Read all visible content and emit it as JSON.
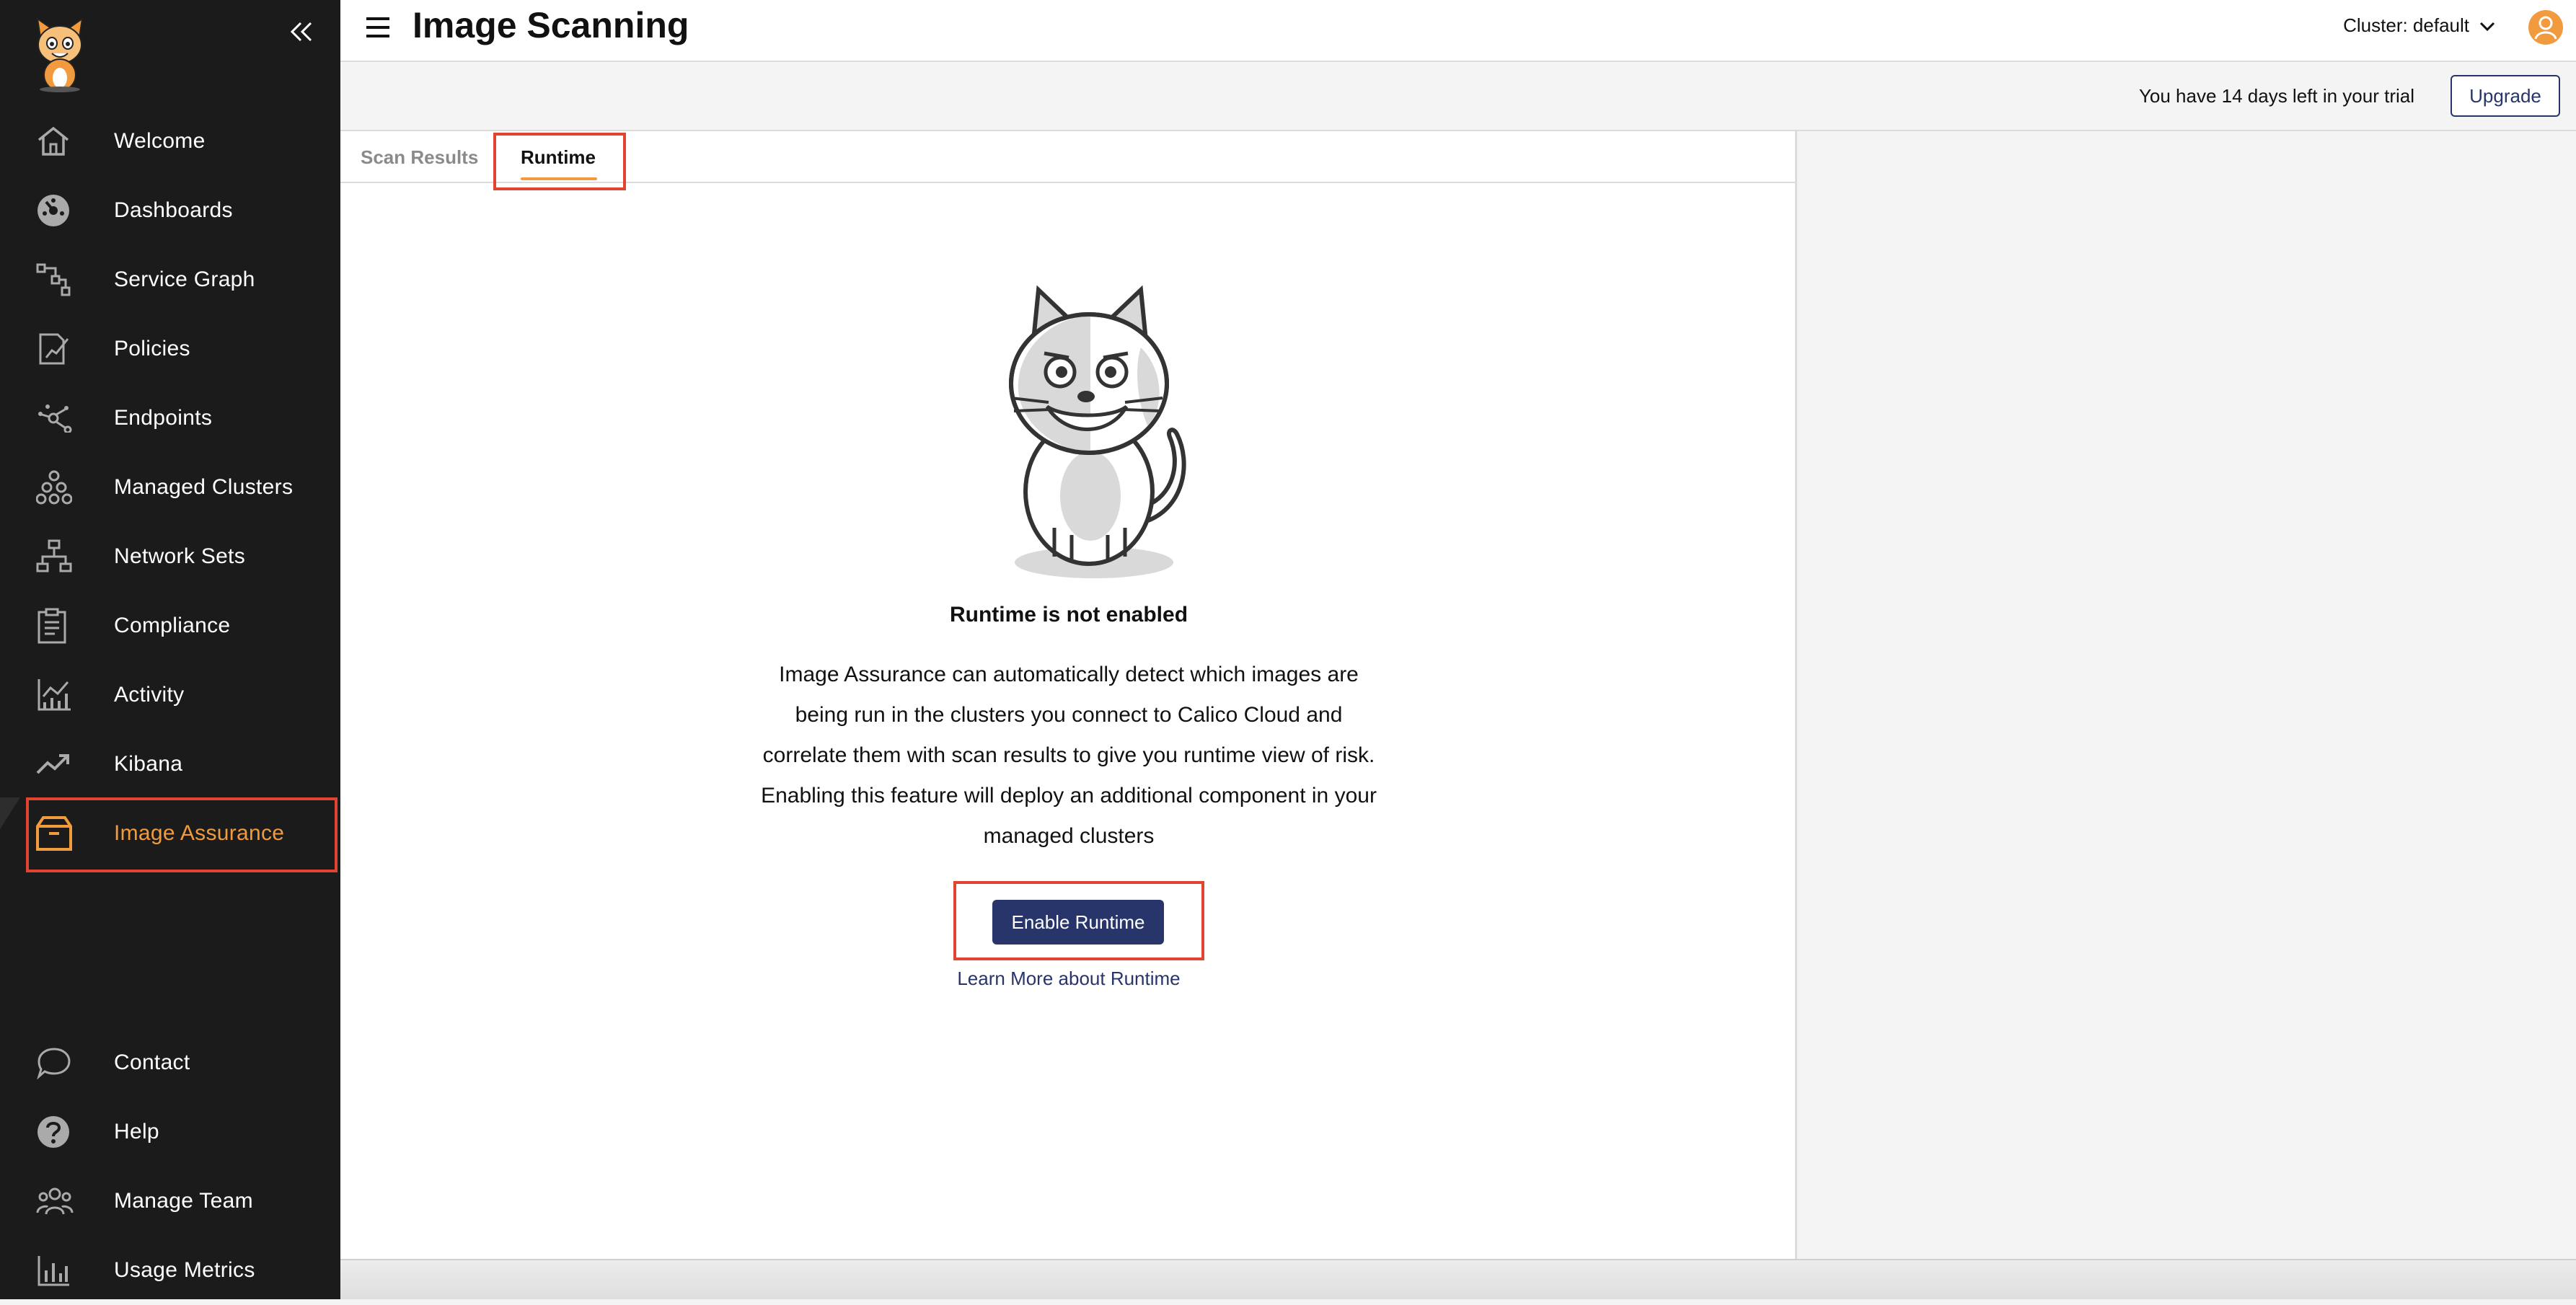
{
  "header": {
    "title": "Image Scanning",
    "cluster_label": "Cluster: default"
  },
  "trial": {
    "text": "You have 14 days left in your trial",
    "upgrade_label": "Upgrade"
  },
  "sidebar": {
    "items": [
      {
        "label": "Welcome",
        "icon": "home-icon"
      },
      {
        "label": "Dashboards",
        "icon": "dashboard-gauge-icon"
      },
      {
        "label": "Service Graph",
        "icon": "service-graph-icon"
      },
      {
        "label": "Policies",
        "icon": "policy-document-icon"
      },
      {
        "label": "Endpoints",
        "icon": "endpoints-icon"
      },
      {
        "label": "Managed Clusters",
        "icon": "clusters-icon"
      },
      {
        "label": "Network Sets",
        "icon": "network-sets-icon"
      },
      {
        "label": "Compliance",
        "icon": "clipboard-icon"
      },
      {
        "label": "Activity",
        "icon": "activity-chart-icon"
      },
      {
        "label": "Kibana",
        "icon": "trend-icon"
      },
      {
        "label": "Image Assurance",
        "icon": "box-icon",
        "active": true
      }
    ],
    "bottom_items": [
      {
        "label": "Contact",
        "icon": "chat-icon"
      },
      {
        "label": "Help",
        "icon": "help-icon"
      },
      {
        "label": "Manage Team",
        "icon": "team-icon"
      },
      {
        "label": "Usage Metrics",
        "icon": "bar-chart-icon"
      }
    ],
    "accent_color": "#f19a3e"
  },
  "tabs": [
    {
      "label": "Scan Results",
      "selected": false
    },
    {
      "label": "Runtime",
      "selected": true
    }
  ],
  "empty_state": {
    "title": "Runtime is not enabled",
    "description": "Image Assurance can automatically detect which images are being run in the clusters you connect to Calico Cloud and correlate them with scan results to give you runtime view of risk. Enabling this feature will deploy an additional component in your managed clusters",
    "button_label": "Enable Runtime",
    "link_label": "Learn More about Runtime"
  },
  "colors": {
    "primary": "#27356b",
    "highlight": "#e2452f",
    "sidebar_bg": "#1b1b1b"
  }
}
